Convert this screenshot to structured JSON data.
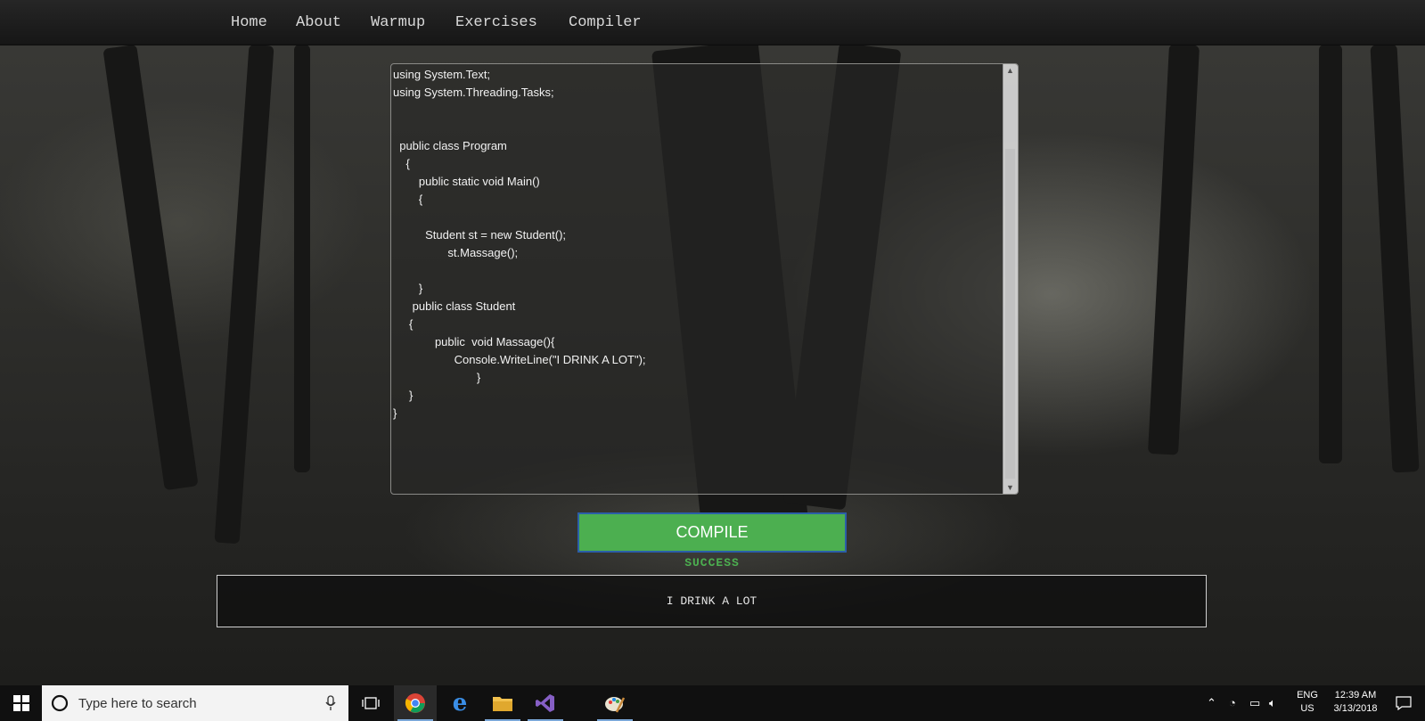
{
  "nav": {
    "items": [
      "Home",
      "About",
      "Warmup",
      "Exercises",
      "Compiler"
    ]
  },
  "editor": {
    "code": "using System.Text;\nusing System.Threading.Tasks;\n\n\n  public class Program\n    {\n        public static void Main()\n        {\n\n          Student st = new Student();\n                 st.Massage();\n\n        }\n      public class Student\n     {\n             public  void Massage(){\n                   Console.WriteLine(\"I DRINK A LOT\");\n                          }\n     }\n}"
  },
  "compile": {
    "button_label": "COMPILE",
    "status": "SUCCESS",
    "output": "I DRINK A LOT"
  },
  "taskbar": {
    "search_placeholder": "Type here to search",
    "language": "ENG",
    "region": "US",
    "time": "12:39 AM",
    "date": "3/13/2018"
  },
  "colors": {
    "compile_green": "#4caf50",
    "nav_bg": "#1e1e1e"
  }
}
